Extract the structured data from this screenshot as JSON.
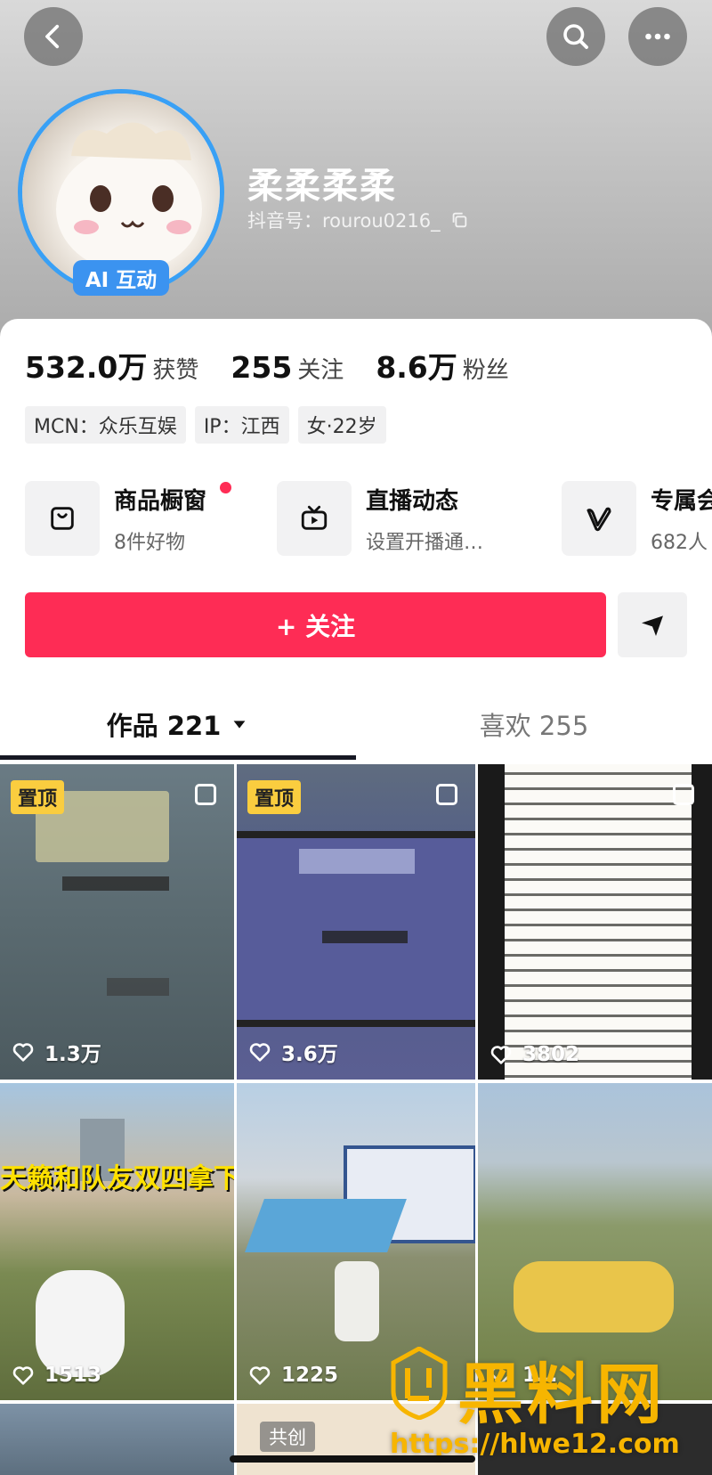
{
  "colors": {
    "accent": "#fe2c55",
    "ai_badge": "#3b93f0",
    "pinned_badge": "#facd3f",
    "watermark": "#f7b500"
  },
  "header": {
    "back_icon": "chevron-left-icon",
    "search_icon": "search-icon",
    "more_icon": "more-horizontal-icon"
  },
  "profile": {
    "ai_badge": "AI 互动",
    "nickname": "柔柔柔柔",
    "douyin_id": "抖音号：rourou0216_",
    "copy_icon": "copy-icon"
  },
  "stats": [
    {
      "value": "532.0万",
      "label": "获赞"
    },
    {
      "value": "255",
      "label": "关注"
    },
    {
      "value": "8.6万",
      "label": "粉丝"
    }
  ],
  "tags": [
    "MCN：众乐互娱",
    "IP：江西",
    "女·22岁"
  ],
  "entries": [
    {
      "title": "商品橱窗",
      "subtitle": "8件好物",
      "icon": "shopping-bag-icon",
      "has_dot": true
    },
    {
      "title": "直播动态",
      "subtitle": "设置开播通…",
      "icon": "tv-icon",
      "has_dot": false
    },
    {
      "title": "专属会",
      "subtitle": "682人",
      "icon": "v-badge-icon",
      "has_dot": false
    }
  ],
  "actions": {
    "follow_label": "+ 关注",
    "share_icon": "send-icon"
  },
  "tabs": [
    {
      "label": "作品 221",
      "active": true,
      "dropdown_icon": "caret-down-icon"
    },
    {
      "label": "喜欢 255",
      "active": false
    }
  ],
  "videos": [
    {
      "likes": "1.3万",
      "pinned": "置顶"
    },
    {
      "likes": "3.6万",
      "pinned": "置顶"
    },
    {
      "likes": "3802"
    },
    {
      "likes": "1513",
      "caption": "天籁和队友双四拿下"
    },
    {
      "likes": "1225"
    },
    {
      "likes": "1…"
    },
    {
      "badge": "共创"
    },
    {},
    {}
  ],
  "watermark": {
    "title": "黑料网",
    "url": "https://hlwe12.com"
  }
}
